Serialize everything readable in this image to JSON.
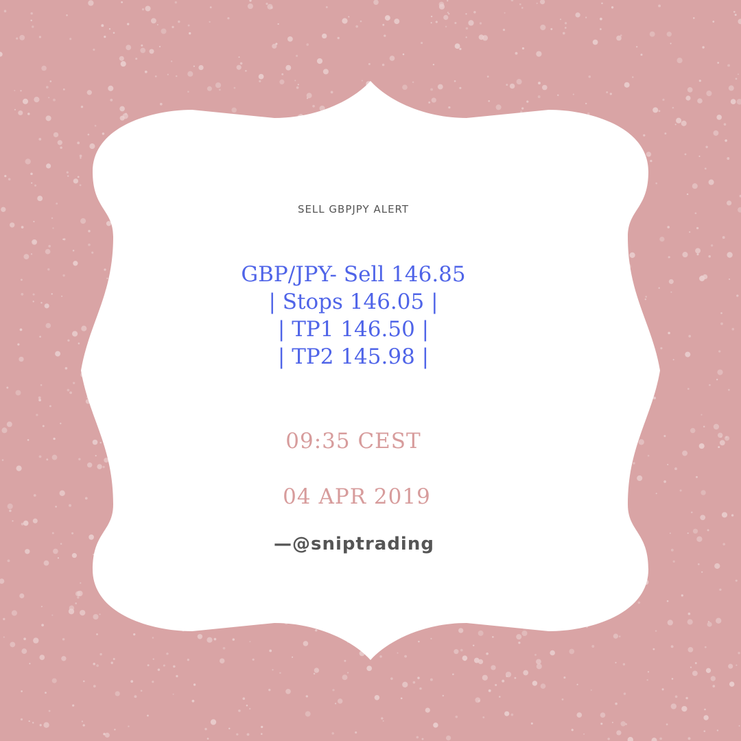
{
  "card": {
    "heading": "SELL GBPJPY ALERT",
    "signal_lines": [
      "GBP/JPY- Sell 146.85",
      "| Stops 146.05 |",
      "| TP1 146.50 |",
      "| TP2 145.98 |"
    ],
    "time": "09:35 CEST",
    "date": "04 APR 2019",
    "handle": "—@sniptrading"
  },
  "colors": {
    "background": "#d9a4a5",
    "speckle": "#ead0d0",
    "card": "#ffffff",
    "signal_text": "#4f64e8",
    "accent_text": "#d79c9c",
    "dark_text": "#555555"
  }
}
